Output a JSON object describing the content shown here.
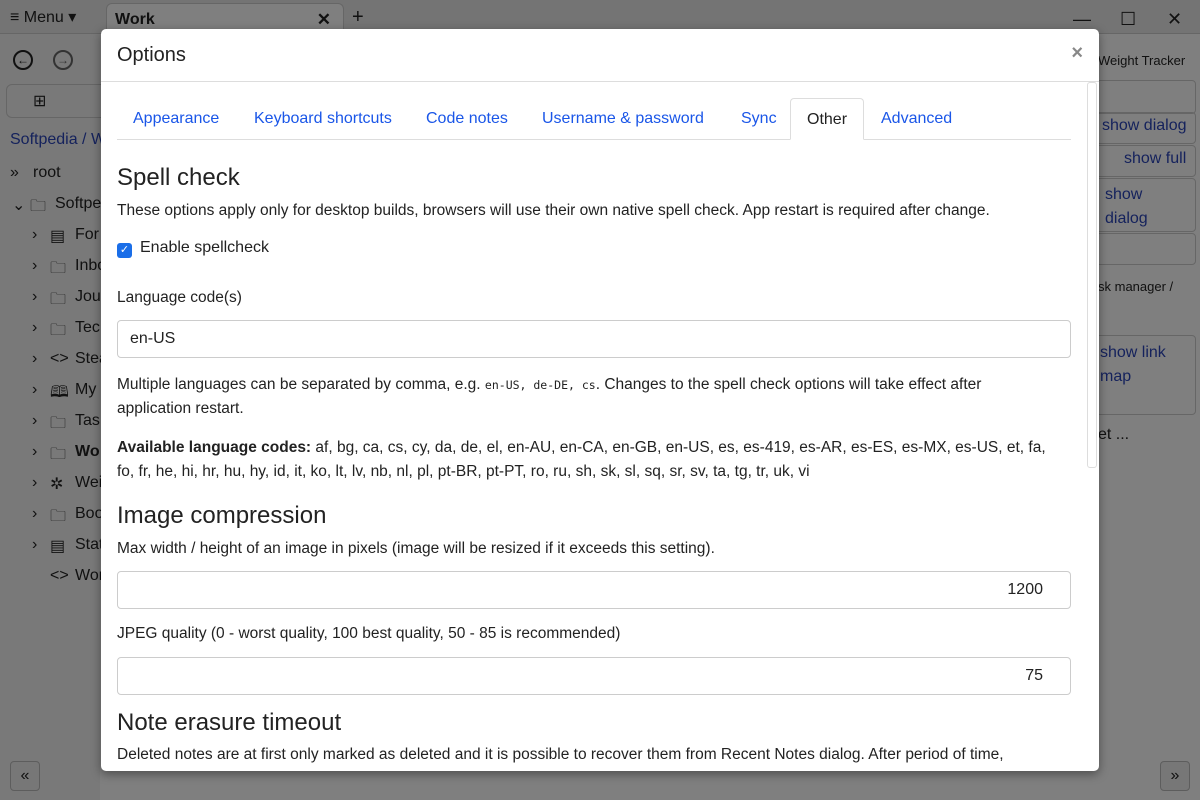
{
  "app": {
    "menu_label": "≡ Menu ▾",
    "tab_title": "Work",
    "tab_close": "✕",
    "new_tab": "+",
    "minimize": "—",
    "maximize": "☐",
    "close": "✕",
    "breadcrumb": "Softpedia / W",
    "tree": [
      {
        "chev": "»",
        "icon": "",
        "label": "root",
        "indent": 0
      },
      {
        "chev": "⌄",
        "icon": "folder",
        "label": "Softpe",
        "indent": 1
      },
      {
        "chev": "›",
        "icon": "book",
        "label": "For",
        "indent": 2
      },
      {
        "chev": "›",
        "icon": "folder",
        "label": "Inbo",
        "indent": 2
      },
      {
        "chev": "›",
        "icon": "folder",
        "label": "Jou",
        "indent": 2
      },
      {
        "chev": "›",
        "icon": "folder",
        "label": "Tec",
        "indent": 2
      },
      {
        "chev": "›",
        "icon": "code",
        "label": "Stea",
        "indent": 2
      },
      {
        "chev": "›",
        "icon": "map",
        "label": "My",
        "indent": 2
      },
      {
        "chev": "›",
        "icon": "folder",
        "label": "Tas",
        "indent": 2
      },
      {
        "chev": "›",
        "icon": "folder",
        "label": "Wo",
        "indent": 2,
        "bold": true
      },
      {
        "chev": "›",
        "icon": "puzzle",
        "label": "Wei",
        "indent": 2
      },
      {
        "chev": "›",
        "icon": "folder",
        "label": "Boo",
        "indent": 2
      },
      {
        "chev": "›",
        "icon": "book",
        "label": "Stat",
        "indent": 2
      },
      {
        "chev": "",
        "icon": "code",
        "label": "Wor",
        "indent": 2
      }
    ],
    "right_panel": {
      "title": "Weight Tracker",
      "btn1": "show dialog",
      "btn2": "show full",
      "btn3": "show dialog",
      "path": "sk manager /",
      "btn4": "show link map",
      "more": "et ..."
    }
  },
  "dialog": {
    "title": "Options",
    "close": "×",
    "tabs": [
      "Appearance",
      "Keyboard shortcuts",
      "Code notes",
      "Username & password",
      "Sync",
      "Other",
      "Advanced"
    ],
    "active_tab": "Other",
    "spell": {
      "heading": "Spell check",
      "desc": "These options apply only for desktop builds, browsers will use their own native spell check. App restart is required after change.",
      "checkbox_label": "Enable spellcheck",
      "checked": true,
      "lang_label": "Language code(s)",
      "lang_value": "en-US",
      "note_a": "Multiple languages can be separated by comma, e.g. ",
      "note_codes": "en-US, de-DE, cs",
      "note_b": ". Changes to the spell check options will take effect after application restart.",
      "avail_label": "Available language codes:",
      "avail": " af, bg, ca, cs, cy, da, de, el, en-AU, en-CA, en-GB, en-US, es, es-419, es-AR, es-ES, es-MX, es-US, et, fa, fo, fr, he, hi, hr, hu, hy, id, it, ko, lt, lv, nb, nl, pl, pt-BR, pt-PT, ro, ru, sh, sk, sl, sq, sr, sv, ta, tg, tr, uk, vi"
    },
    "image": {
      "heading": "Image compression",
      "max_label": "Max width / height of an image in pixels (image will be resized if it exceeds this setting).",
      "max_value": "1200",
      "jpeg_label": "JPEG quality (0 - worst quality, 100 best quality, 50 - 85 is recommended)",
      "jpeg_value": "75"
    },
    "erasure": {
      "heading": "Note erasure timeout",
      "desc": "Deleted notes are at first only marked as deleted and it is possible to recover them from Recent Notes dialog. After period of time,"
    }
  }
}
